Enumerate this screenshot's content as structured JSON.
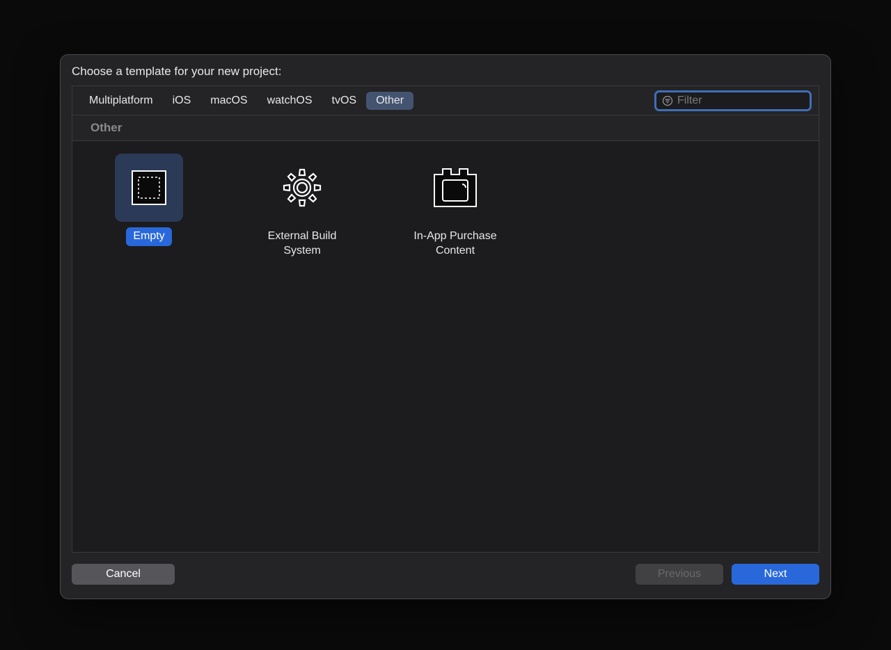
{
  "title": "Choose a template for your new project:",
  "tabs": [
    {
      "label": "Multiplatform",
      "active": false
    },
    {
      "label": "iOS",
      "active": false
    },
    {
      "label": "macOS",
      "active": false
    },
    {
      "label": "watchOS",
      "active": false
    },
    {
      "label": "tvOS",
      "active": false
    },
    {
      "label": "Other",
      "active": true
    }
  ],
  "filter": {
    "placeholder": "Filter",
    "value": "",
    "icon": "filter-icon"
  },
  "section_header": "Other",
  "templates": [
    {
      "label": "Empty",
      "icon": "empty-template-icon",
      "selected": true
    },
    {
      "label": "External Build System",
      "icon": "gear-icon",
      "selected": false
    },
    {
      "label": "In-App Purchase Content",
      "icon": "iap-content-icon",
      "selected": false
    }
  ],
  "buttons": {
    "cancel": "Cancel",
    "previous": "Previous",
    "next": "Next"
  }
}
